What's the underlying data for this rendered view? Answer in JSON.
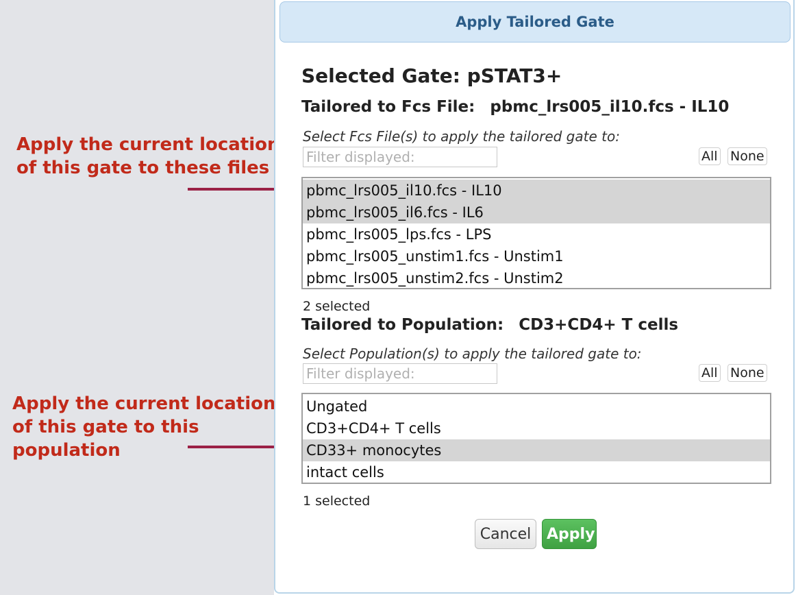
{
  "dialog": {
    "title": "Apply Tailored Gate",
    "selected_gate_label": "Selected Gate: pSTAT3+"
  },
  "fcs": {
    "tailored_label": "Tailored to Fcs File:",
    "tailored_value": "pbmc_lrs005_il10.fcs - IL10",
    "hint": "Select Fcs File(s) to apply the tailored gate to:",
    "filter_placeholder": "Filter displayed:",
    "all_label": "All",
    "none_label": "None",
    "options": [
      {
        "label": "pbmc_lrs005_il10.fcs - IL10",
        "selected": true
      },
      {
        "label": "pbmc_lrs005_il6.fcs - IL6",
        "selected": true
      },
      {
        "label": "pbmc_lrs005_lps.fcs - LPS",
        "selected": false
      },
      {
        "label": "pbmc_lrs005_unstim1.fcs - Unstim1",
        "selected": false
      },
      {
        "label": "pbmc_lrs005_unstim2.fcs - Unstim2",
        "selected": false
      }
    ],
    "count_text": "2 selected"
  },
  "population": {
    "tailored_label": "Tailored to Population:",
    "tailored_value": "CD3+CD4+ T cells",
    "hint": "Select Population(s) to apply the tailored gate to:",
    "filter_placeholder": "Filter displayed:",
    "all_label": "All",
    "none_label": "None",
    "options": [
      {
        "label": "Ungated",
        "selected": false
      },
      {
        "label": "CD3+CD4+ T cells",
        "selected": false
      },
      {
        "label": "CD33+ monocytes",
        "selected": true
      },
      {
        "label": "intact cells",
        "selected": false
      }
    ],
    "count_text": "1 selected"
  },
  "buttons": {
    "cancel_label": "Cancel",
    "apply_label": "Apply"
  },
  "annotations": {
    "files_note": "Apply the current location\nof this gate to these files",
    "population_note": "Apply the current location\nof this gate to this\npopulation",
    "text_color": "#c12a1a",
    "arrow_color": "#9b2146"
  }
}
